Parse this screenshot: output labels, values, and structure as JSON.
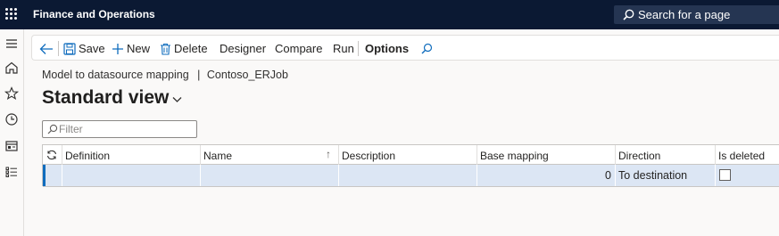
{
  "app": {
    "title": "Finance and Operations",
    "search_label": "Search for a page"
  },
  "left_nav": [
    "hamburger-icon",
    "home-icon",
    "star-icon",
    "clock-icon",
    "workspace-icon",
    "list-icon"
  ],
  "actions": {
    "save": "Save",
    "new": "New",
    "delete": "Delete",
    "designer": "Designer",
    "compare": "Compare",
    "run": "Run",
    "options": "Options"
  },
  "breadcrumb": {
    "parent": "Model to datasource mapping",
    "separator": "|",
    "current": "Contoso_ERJob"
  },
  "view": {
    "title": "Standard view"
  },
  "filter": {
    "placeholder": "Filter"
  },
  "grid": {
    "columns": [
      "Definition",
      "Name",
      "Description",
      "Base mapping",
      "Direction",
      "Is deleted"
    ],
    "sort_indicator": "↑",
    "rows": [
      {
        "definition": "",
        "name": "",
        "description": "",
        "base_mapping": "0",
        "direction": "To destination",
        "is_deleted": false
      }
    ]
  },
  "colors": {
    "topbar": "#0b1933",
    "accent": "#0f6cbd",
    "selected_row": "#dce6f4"
  }
}
